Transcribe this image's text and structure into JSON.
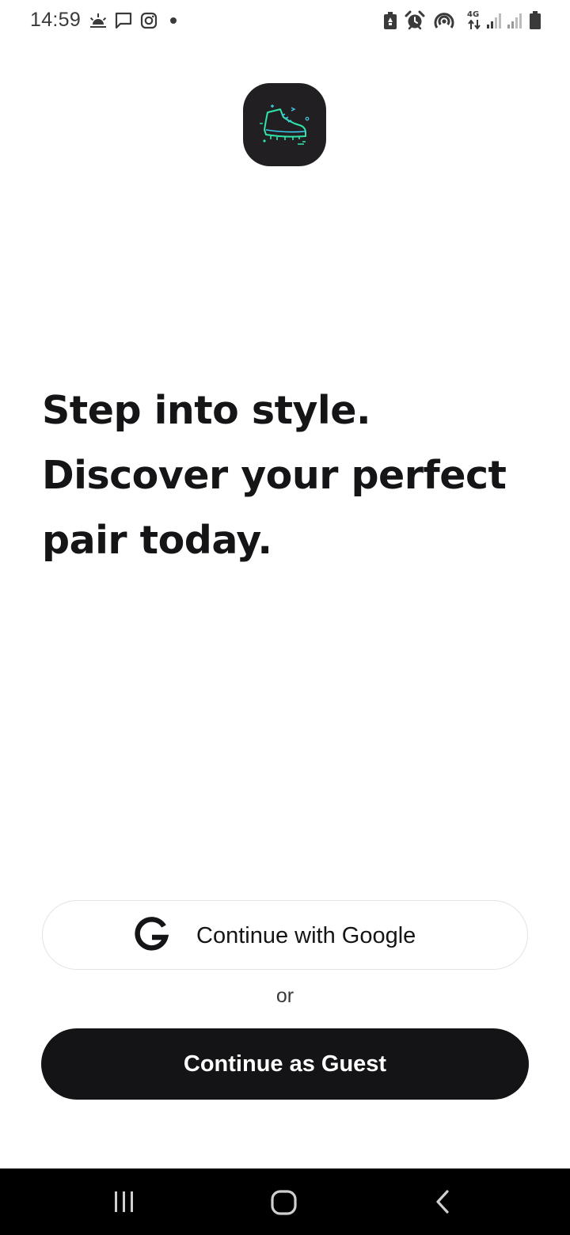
{
  "status_bar": {
    "time": "14:59",
    "left_icons": [
      "weather-icon",
      "message-icon",
      "instagram-icon",
      "notification-dot-icon"
    ],
    "right_icons": [
      "battery-saver-icon",
      "alarm-icon",
      "hotspot-icon",
      "4g-data-icon",
      "signal-icon",
      "signal-icon",
      "battery-icon"
    ],
    "network_label": "4G"
  },
  "app": {
    "logo_icon": "shoe-icon",
    "logo_bg_color": "#211f21",
    "logo_accent_colors": [
      "#2fe6a8",
      "#3cc9e8"
    ]
  },
  "headline": {
    "lines": [
      "Step into style.",
      "Discover your perfect",
      "pair today."
    ]
  },
  "auth": {
    "google_button_label": "Continue with Google",
    "google_icon": "google-icon",
    "or_text": "or",
    "guest_button_label": "Continue as Guest"
  },
  "navigation_bar": {
    "buttons": [
      "recent-apps-icon",
      "home-icon",
      "back-icon"
    ]
  },
  "colors": {
    "primary_dark": "#141316",
    "background": "#ffffff",
    "border": "#e3e3e3"
  }
}
